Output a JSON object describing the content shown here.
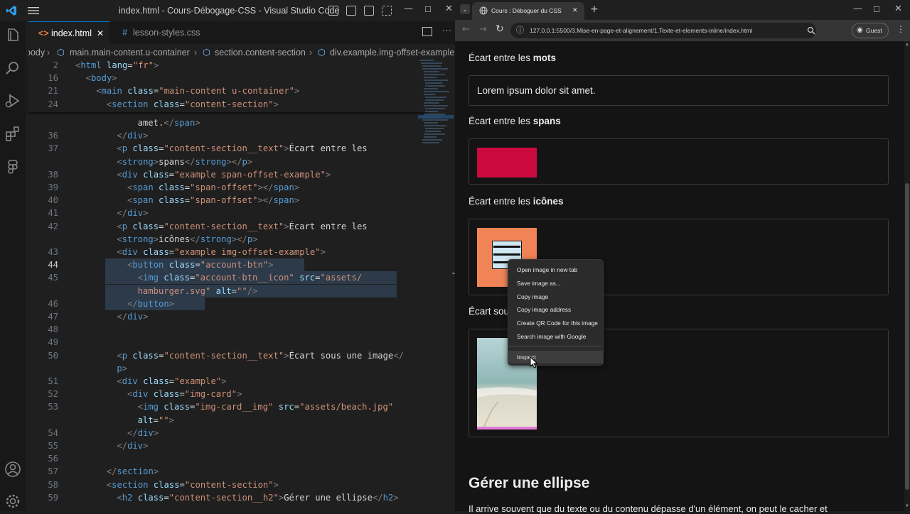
{
  "vscode": {
    "window_title": "index.html - Cours-Débogage-CSS - Visual Studio Code",
    "tabs": [
      {
        "label": "index.html",
        "icon": "<>",
        "close": "✕"
      },
      {
        "label": "lesson-styles.css",
        "icon": "#"
      }
    ],
    "breadcrumbs": [
      "body",
      "main.main-content.u-container",
      "section.content-section",
      "div.example.img-offset-example"
    ],
    "sticky_lines": [
      {
        "num": "2",
        "parts": [
          [
            "t",
            "<"
          ],
          [
            "tg",
            "html "
          ],
          [
            "at",
            "lang"
          ],
          [
            "tx",
            "="
          ],
          [
            "st",
            "\"fr\""
          ],
          [
            "t",
            ">"
          ]
        ],
        "indent": 0
      },
      {
        "num": "16",
        "parts": [
          [
            "t",
            "<"
          ],
          [
            "tg",
            "body"
          ],
          [
            "t",
            ">"
          ]
        ],
        "indent": 1
      },
      {
        "num": "21",
        "parts": [
          [
            "t",
            "<"
          ],
          [
            "tg",
            "main "
          ],
          [
            "at",
            "class"
          ],
          [
            "tx",
            "="
          ],
          [
            "st",
            "\"main-content u-container\""
          ],
          [
            "t",
            ">"
          ]
        ],
        "indent": 2
      },
      {
        "num": "24",
        "parts": [
          [
            "t",
            "<"
          ],
          [
            "tg",
            "section "
          ],
          [
            "at",
            "class"
          ],
          [
            "tx",
            "="
          ],
          [
            "st",
            "\"content-section\""
          ],
          [
            "t",
            ">"
          ]
        ],
        "indent": 3
      }
    ],
    "lines": [
      {
        "num": "",
        "parts": [
          [
            "tx",
            "amet."
          ],
          [
            "t",
            "</"
          ],
          [
            "tg",
            "span"
          ],
          [
            "t",
            ">"
          ]
        ],
        "indent": 6
      },
      {
        "num": "36",
        "parts": [
          [
            "t",
            "</"
          ],
          [
            "tg",
            "div"
          ],
          [
            "t",
            ">"
          ]
        ],
        "indent": 4
      },
      {
        "num": "37",
        "parts": [
          [
            "t",
            "<"
          ],
          [
            "tg",
            "p "
          ],
          [
            "at",
            "class"
          ],
          [
            "tx",
            "="
          ],
          [
            "st",
            "\"content-section__text\""
          ],
          [
            "t",
            ">"
          ],
          [
            "tx",
            "Écart entre les"
          ]
        ],
        "indent": 4
      },
      {
        "num": "",
        "parts": [
          [
            "t",
            "<"
          ],
          [
            "tg",
            "strong"
          ],
          [
            "t",
            ">"
          ],
          [
            "tx",
            "spans"
          ],
          [
            "t",
            "</"
          ],
          [
            "tg",
            "strong"
          ],
          [
            "t",
            "></"
          ],
          [
            "tg",
            "p"
          ],
          [
            "t",
            ">"
          ]
        ],
        "indent": 4
      },
      {
        "num": "38",
        "parts": [
          [
            "t",
            "<"
          ],
          [
            "tg",
            "div "
          ],
          [
            "at",
            "class"
          ],
          [
            "tx",
            "="
          ],
          [
            "st",
            "\"example span-offset-example\""
          ],
          [
            "t",
            ">"
          ]
        ],
        "indent": 4
      },
      {
        "num": "39",
        "parts": [
          [
            "t",
            "<"
          ],
          [
            "tg",
            "span "
          ],
          [
            "at",
            "class"
          ],
          [
            "tx",
            "="
          ],
          [
            "st",
            "\"span-offset\""
          ],
          [
            "t",
            "></"
          ],
          [
            "tg",
            "span"
          ],
          [
            "t",
            ">"
          ]
        ],
        "indent": 5
      },
      {
        "num": "40",
        "parts": [
          [
            "t",
            "<"
          ],
          [
            "tg",
            "span "
          ],
          [
            "at",
            "class"
          ],
          [
            "tx",
            "="
          ],
          [
            "st",
            "\"span-offset\""
          ],
          [
            "t",
            "></"
          ],
          [
            "tg",
            "span"
          ],
          [
            "t",
            ">"
          ]
        ],
        "indent": 5
      },
      {
        "num": "41",
        "parts": [
          [
            "t",
            "</"
          ],
          [
            "tg",
            "div"
          ],
          [
            "t",
            ">"
          ]
        ],
        "indent": 4
      },
      {
        "num": "42",
        "parts": [
          [
            "t",
            "<"
          ],
          [
            "tg",
            "p "
          ],
          [
            "at",
            "class"
          ],
          [
            "tx",
            "="
          ],
          [
            "st",
            "\"content-section__text\""
          ],
          [
            "t",
            ">"
          ],
          [
            "tx",
            "Écart entre les"
          ]
        ],
        "indent": 4
      },
      {
        "num": "",
        "parts": [
          [
            "t",
            "<"
          ],
          [
            "tg",
            "strong"
          ],
          [
            "t",
            ">"
          ],
          [
            "tx",
            "icônes"
          ],
          [
            "t",
            "</"
          ],
          [
            "tg",
            "strong"
          ],
          [
            "t",
            "></"
          ],
          [
            "tg",
            "p"
          ],
          [
            "t",
            ">"
          ]
        ],
        "indent": 4
      },
      {
        "num": "43",
        "parts": [
          [
            "t",
            "<"
          ],
          [
            "tg",
            "div "
          ],
          [
            "at",
            "class"
          ],
          [
            "tx",
            "="
          ],
          [
            "st",
            "\"example img-offset-example\""
          ],
          [
            "t",
            ">"
          ]
        ],
        "indent": 4
      },
      {
        "num": "44",
        "parts": [
          [
            "t",
            "<"
          ],
          [
            "tg",
            "button "
          ],
          [
            "at",
            "class"
          ],
          [
            "tx",
            "="
          ],
          [
            "st",
            "\"account-btn\""
          ],
          [
            "t",
            ">"
          ]
        ],
        "indent": 5,
        "hl": true,
        "cur": true
      },
      {
        "num": "45",
        "parts": [
          [
            "t",
            "<"
          ],
          [
            "tg",
            "img "
          ],
          [
            "at",
            "class"
          ],
          [
            "tx",
            "="
          ],
          [
            "st",
            "\"account-btn__icon\" "
          ],
          [
            "at",
            "src"
          ],
          [
            "tx",
            "="
          ],
          [
            "st",
            "\"assets/"
          ]
        ],
        "indent": 6,
        "hl": true
      },
      {
        "num": "",
        "parts": [
          [
            "st",
            "hamburger.svg\" "
          ],
          [
            "at",
            "alt"
          ],
          [
            "tx",
            "="
          ],
          [
            "st",
            "\"\""
          ],
          [
            "t",
            "/>"
          ]
        ],
        "indent": 6,
        "hl": true
      },
      {
        "num": "46",
        "parts": [
          [
            "t",
            "</"
          ],
          [
            "tg",
            "button"
          ],
          [
            "t",
            ">"
          ]
        ],
        "indent": 5,
        "hl": true
      },
      {
        "num": "47",
        "parts": [
          [
            "t",
            "</"
          ],
          [
            "tg",
            "div"
          ],
          [
            "t",
            ">"
          ]
        ],
        "indent": 4
      },
      {
        "num": "48",
        "parts": [],
        "indent": 4
      },
      {
        "num": "49",
        "parts": [],
        "indent": 4
      },
      {
        "num": "50",
        "parts": [
          [
            "t",
            "<"
          ],
          [
            "tg",
            "p "
          ],
          [
            "at",
            "class"
          ],
          [
            "tx",
            "="
          ],
          [
            "st",
            "\"content-section__text\""
          ],
          [
            "t",
            ">"
          ],
          [
            "tx",
            "Écart sous une image"
          ],
          [
            "t",
            "</"
          ]
        ],
        "indent": 4
      },
      {
        "num": "",
        "parts": [
          [
            "tg",
            "p"
          ],
          [
            "t",
            ">"
          ]
        ],
        "indent": 4
      },
      {
        "num": "51",
        "parts": [
          [
            "t",
            "<"
          ],
          [
            "tg",
            "div "
          ],
          [
            "at",
            "class"
          ],
          [
            "tx",
            "="
          ],
          [
            "st",
            "\"example\""
          ],
          [
            "t",
            ">"
          ]
        ],
        "indent": 4
      },
      {
        "num": "52",
        "parts": [
          [
            "t",
            "<"
          ],
          [
            "tg",
            "div "
          ],
          [
            "at",
            "class"
          ],
          [
            "tx",
            "="
          ],
          [
            "st",
            "\"img-card\""
          ],
          [
            "t",
            ">"
          ]
        ],
        "indent": 5
      },
      {
        "num": "53",
        "parts": [
          [
            "t",
            "<"
          ],
          [
            "tg",
            "img "
          ],
          [
            "at",
            "class"
          ],
          [
            "tx",
            "="
          ],
          [
            "st",
            "\"img-card__img\" "
          ],
          [
            "at",
            "src"
          ],
          [
            "tx",
            "="
          ],
          [
            "st",
            "\"assets/beach.jpg\""
          ]
        ],
        "indent": 6
      },
      {
        "num": "",
        "parts": [
          [
            "at",
            "alt"
          ],
          [
            "tx",
            "="
          ],
          [
            "st",
            "\"\""
          ],
          [
            "t",
            ">"
          ]
        ],
        "indent": 6
      },
      {
        "num": "54",
        "parts": [
          [
            "t",
            "</"
          ],
          [
            "tg",
            "div"
          ],
          [
            "t",
            ">"
          ]
        ],
        "indent": 5
      },
      {
        "num": "55",
        "parts": [
          [
            "t",
            "</"
          ],
          [
            "tg",
            "div"
          ],
          [
            "t",
            ">"
          ]
        ],
        "indent": 4
      },
      {
        "num": "56",
        "parts": [],
        "indent": 4
      },
      {
        "num": "57",
        "parts": [
          [
            "t",
            "</"
          ],
          [
            "tg",
            "section"
          ],
          [
            "t",
            ">"
          ]
        ],
        "indent": 3
      },
      {
        "num": "58",
        "parts": [
          [
            "t",
            "<"
          ],
          [
            "tg",
            "section "
          ],
          [
            "at",
            "class"
          ],
          [
            "tx",
            "="
          ],
          [
            "st",
            "\"content-section\""
          ],
          [
            "t",
            ">"
          ]
        ],
        "indent": 3
      },
      {
        "num": "59",
        "parts": [
          [
            "t",
            "<"
          ],
          [
            "tg",
            "h2 "
          ],
          [
            "at",
            "class"
          ],
          [
            "tx",
            "="
          ],
          [
            "st",
            "\"content-section__h2\""
          ],
          [
            "t",
            ">"
          ],
          [
            "tx",
            "Gérer une ellipse"
          ],
          [
            "t",
            "</"
          ],
          [
            "tg",
            "h2"
          ],
          [
            "t",
            ">"
          ]
        ],
        "indent": 4
      }
    ]
  },
  "browser": {
    "tab_title": "Cours : Déboguer du CSS",
    "tab_close": "✕",
    "new_tab": "+",
    "url": "127.0.0.1:5500/3.Mise-en-page-et-alignement/1.Texte-et-elements-inline/index.html",
    "profile": "Guest",
    "sections": [
      {
        "prefix": "Écart entre les ",
        "bold": "mots"
      },
      {
        "prefix": "Écart entre les ",
        "bold": "spans"
      },
      {
        "prefix": "Écart entre les ",
        "bold": "icônes"
      },
      {
        "prefix": "Écart sou",
        "bold": ""
      }
    ],
    "lorem": "Lorem ipsum dolor sit amet.",
    "heading": "Gérer une ellipse",
    "bottom_text": "Il arrive souvent que du texte ou du contenu dépasse d'un élément, on peut le cacher et",
    "span_color": "#cc0a3f",
    "icon_bg": "#f08457"
  },
  "context_menu": {
    "items": [
      "Open image in new tab",
      "Save image as...",
      "Copy image",
      "Copy image address",
      "Create QR Code for this image",
      "Search image with Google",
      "Inspect"
    ]
  }
}
